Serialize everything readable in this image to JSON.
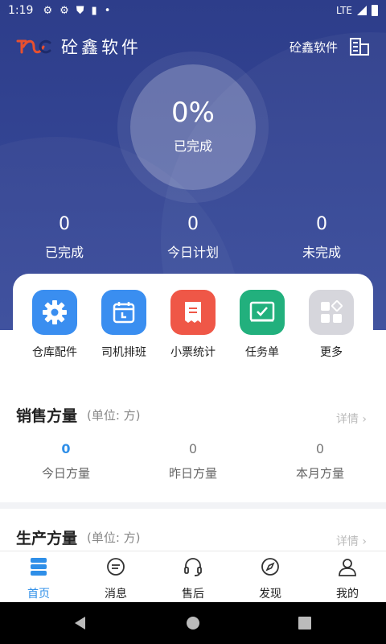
{
  "status_bar": {
    "time": "1:19",
    "network": "LTE"
  },
  "app_bar": {
    "title": "砼鑫软件",
    "company": "砼鑫软件"
  },
  "progress": {
    "value": "0%",
    "label": "已完成"
  },
  "stats": [
    {
      "value": "0",
      "label": "已完成"
    },
    {
      "value": "0",
      "label": "今日计划"
    },
    {
      "value": "0",
      "label": "未完成"
    }
  ],
  "quick_actions": [
    {
      "label": "仓库配件",
      "color": "#3a8ef0",
      "icon": "gear-icon"
    },
    {
      "label": "司机排班",
      "color": "#3a8ef0",
      "icon": "calendar-icon"
    },
    {
      "label": "小票统计",
      "color": "#ef5747",
      "icon": "receipt-icon"
    },
    {
      "label": "任务单",
      "color": "#22b07d",
      "icon": "task-check-icon"
    },
    {
      "label": "更多",
      "color": "#d6d6dc",
      "icon": "grid-more-icon"
    }
  ],
  "sales": {
    "title": "销售方量",
    "unit": "(单位: 方)",
    "more": "详情 ›",
    "items": [
      {
        "value": "0",
        "label": "今日方量"
      },
      {
        "value": "0",
        "label": "昨日方量"
      },
      {
        "value": "0",
        "label": "本月方量"
      }
    ]
  },
  "production": {
    "title": "生产方量",
    "unit": "(单位: 方)",
    "more": "详情 ›"
  },
  "tabs": [
    {
      "label": "首页",
      "icon": "home-stack-icon",
      "active": true
    },
    {
      "label": "消息",
      "icon": "message-icon",
      "active": false
    },
    {
      "label": "售后",
      "icon": "headset-icon",
      "active": false
    },
    {
      "label": "发现",
      "icon": "compass-icon",
      "active": false
    },
    {
      "label": "我的",
      "icon": "user-icon",
      "active": false
    }
  ],
  "colors": {
    "primary": "#2d3d8a",
    "accent": "#2f8fe8"
  }
}
